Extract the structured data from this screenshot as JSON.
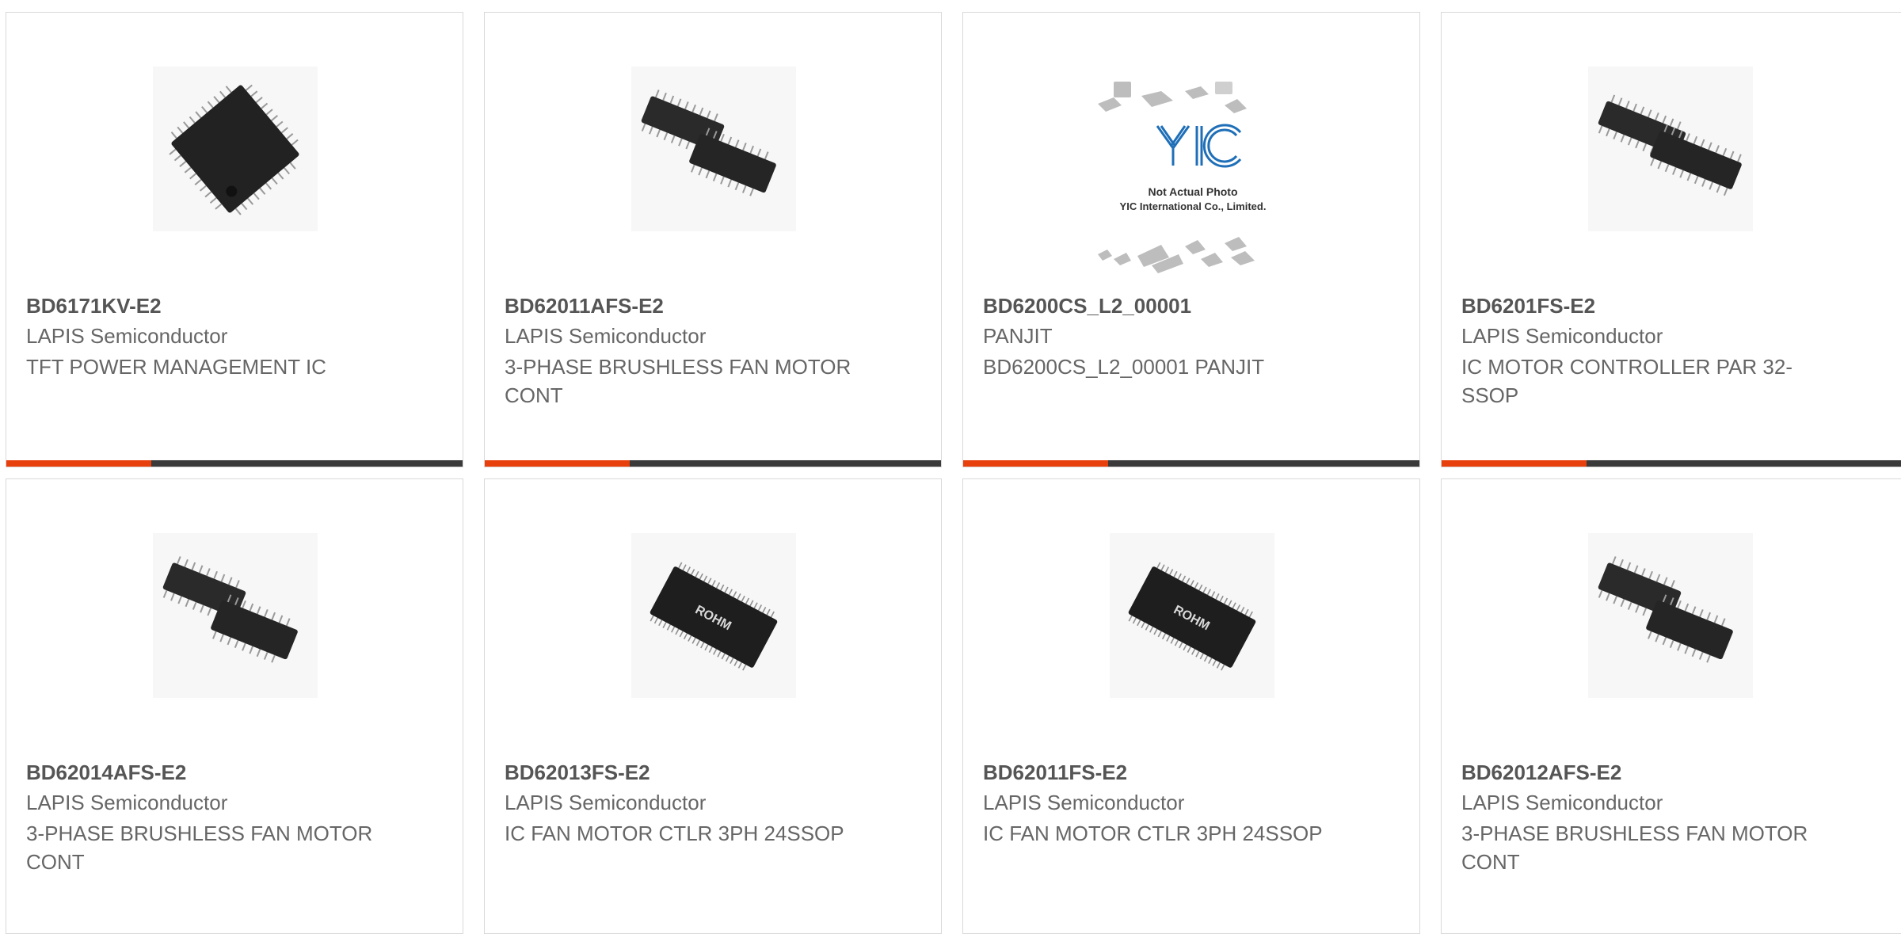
{
  "accent_color": "#e8400c",
  "bar_color": "#3a3a3a",
  "products": [
    {
      "part": "BD6171KV-E2",
      "manufacturer": "LAPIS Semiconductor",
      "description": "TFT POWER MANAGEMENT IC",
      "image": "qfp-chip-icon"
    },
    {
      "part": "BD62011AFS-E2",
      "manufacturer": "LAPIS Semiconductor",
      "description": "3-PHASE BRUSHLESS FAN MOTOR CONT",
      "image": "ssop-pair-icon"
    },
    {
      "part": "BD6200CS_L2_00001",
      "manufacturer": "PANJIT",
      "description": "BD6200CS_L2_00001 PANJIT",
      "image": "yic-placeholder-icon",
      "image_text": {
        "logo": "YIC",
        "line1": "Not Actual Photo",
        "line2": "YIC International Co., Limited."
      }
    },
    {
      "part": "BD6201FS-E2",
      "manufacturer": "LAPIS Semiconductor",
      "description": "IC MOTOR CONTROLLER PAR 32-SSOP",
      "image": "ssop-pair-icon"
    },
    {
      "part": "BD62014AFS-E2",
      "manufacturer": "LAPIS Semiconductor",
      "description": "3-PHASE BRUSHLESS FAN MOTOR CONT",
      "image": "ssop-pair-icon"
    },
    {
      "part": "BD62013FS-E2",
      "manufacturer": "LAPIS Semiconductor",
      "description": "IC FAN MOTOR CTLR 3PH 24SSOP",
      "image": "rohm-ssop-icon",
      "chip_mark": "ROHM"
    },
    {
      "part": "BD62011FS-E2",
      "manufacturer": "LAPIS Semiconductor",
      "description": "IC FAN MOTOR CTLR 3PH 24SSOP",
      "image": "rohm-ssop-icon",
      "chip_mark": "ROHM"
    },
    {
      "part": "BD62012AFS-E2",
      "manufacturer": "LAPIS Semiconductor",
      "description": "3-PHASE BRUSHLESS FAN MOTOR CONT",
      "image": "ssop-pair-icon"
    }
  ]
}
